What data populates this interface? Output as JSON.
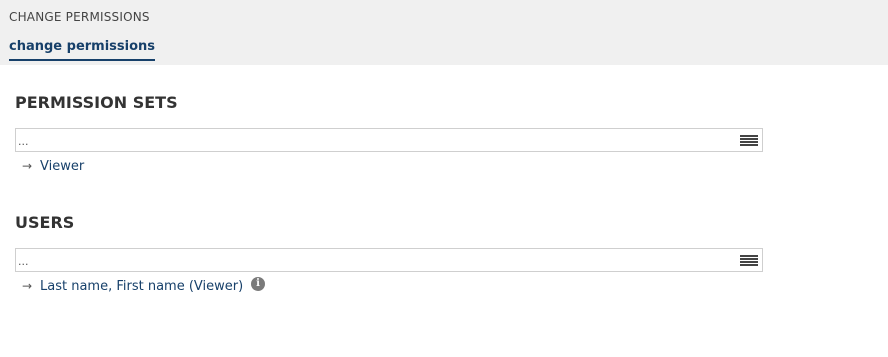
{
  "header": {
    "title": "CHANGE PERMISSIONS",
    "active_tab": "change permissions"
  },
  "permission_sets": {
    "title": "PERMISSION SETS",
    "input_value": "...",
    "items": [
      {
        "label": "Viewer"
      }
    ]
  },
  "users": {
    "title": "USERS",
    "input_value": "...",
    "items": [
      {
        "label": "Last name, First name (Viewer)"
      }
    ]
  },
  "icons": {
    "arrow": "→",
    "info": "i"
  },
  "colors": {
    "accent": "#17406a",
    "header_bg": "#f0f0f0"
  }
}
